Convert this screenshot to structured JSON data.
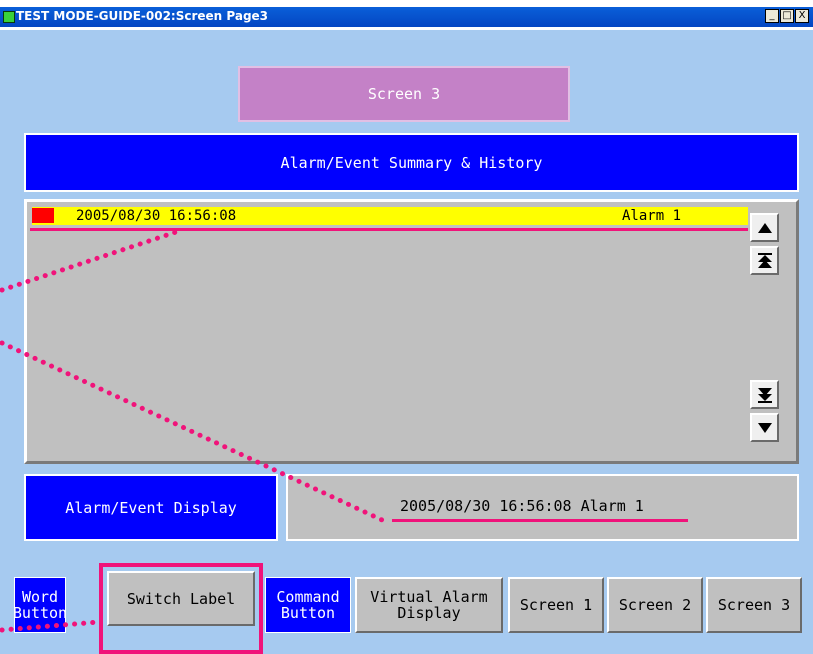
{
  "window": {
    "title": "TEST MODE-GUIDE-002:Screen Page3",
    "controls": [
      "_",
      "□",
      "X"
    ]
  },
  "screen_title": "Screen 3",
  "alarm_summary": {
    "header": "Alarm/Event Summary & History",
    "rows": [
      {
        "timestamp": "2005/08/30 16:56:08",
        "message": "Alarm 1",
        "row_color": "#ffff00",
        "marker_color": "#ff0000"
      }
    ],
    "scroll_icons": [
      "up-arrow-icon",
      "page-up-icon",
      "page-down-icon",
      "down-arrow-icon"
    ]
  },
  "alarm_display": {
    "label": "Alarm/Event Display",
    "value": "2005/08/30 16:56:08 Alarm 1"
  },
  "nav_buttons": [
    {
      "label": "Word Button",
      "style": "blue"
    },
    {
      "label": "Switch Label",
      "style": "grey"
    },
    {
      "label": "Command Button",
      "style": "blue"
    },
    {
      "label": "Virtual Alarm Display",
      "style": "grey"
    },
    {
      "label": "Screen 1",
      "style": "grey"
    },
    {
      "label": "Screen 2",
      "style": "grey"
    },
    {
      "label": "Screen 3",
      "style": "grey"
    }
  ],
  "colors": {
    "background": "#a6caf0",
    "accent_blue": "#0000ff",
    "annotation_pink": "#f0137a",
    "screen_title_bg": "#c481c7"
  }
}
